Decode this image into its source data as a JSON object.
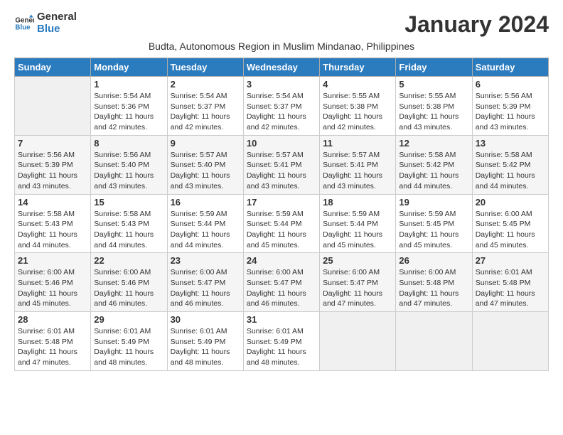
{
  "logo": {
    "line1": "General",
    "line2": "Blue"
  },
  "title": "January 2024",
  "subtitle": "Budta, Autonomous Region in Muslim Mindanao, Philippines",
  "headers": [
    "Sunday",
    "Monday",
    "Tuesday",
    "Wednesday",
    "Thursday",
    "Friday",
    "Saturday"
  ],
  "weeks": [
    [
      {
        "day": "",
        "info": ""
      },
      {
        "day": "1",
        "info": "Sunrise: 5:54 AM\nSunset: 5:36 PM\nDaylight: 11 hours\nand 42 minutes."
      },
      {
        "day": "2",
        "info": "Sunrise: 5:54 AM\nSunset: 5:37 PM\nDaylight: 11 hours\nand 42 minutes."
      },
      {
        "day": "3",
        "info": "Sunrise: 5:54 AM\nSunset: 5:37 PM\nDaylight: 11 hours\nand 42 minutes."
      },
      {
        "day": "4",
        "info": "Sunrise: 5:55 AM\nSunset: 5:38 PM\nDaylight: 11 hours\nand 42 minutes."
      },
      {
        "day": "5",
        "info": "Sunrise: 5:55 AM\nSunset: 5:38 PM\nDaylight: 11 hours\nand 43 minutes."
      },
      {
        "day": "6",
        "info": "Sunrise: 5:56 AM\nSunset: 5:39 PM\nDaylight: 11 hours\nand 43 minutes."
      }
    ],
    [
      {
        "day": "7",
        "info": "Sunrise: 5:56 AM\nSunset: 5:39 PM\nDaylight: 11 hours\nand 43 minutes."
      },
      {
        "day": "8",
        "info": "Sunrise: 5:56 AM\nSunset: 5:40 PM\nDaylight: 11 hours\nand 43 minutes."
      },
      {
        "day": "9",
        "info": "Sunrise: 5:57 AM\nSunset: 5:40 PM\nDaylight: 11 hours\nand 43 minutes."
      },
      {
        "day": "10",
        "info": "Sunrise: 5:57 AM\nSunset: 5:41 PM\nDaylight: 11 hours\nand 43 minutes."
      },
      {
        "day": "11",
        "info": "Sunrise: 5:57 AM\nSunset: 5:41 PM\nDaylight: 11 hours\nand 43 minutes."
      },
      {
        "day": "12",
        "info": "Sunrise: 5:58 AM\nSunset: 5:42 PM\nDaylight: 11 hours\nand 44 minutes."
      },
      {
        "day": "13",
        "info": "Sunrise: 5:58 AM\nSunset: 5:42 PM\nDaylight: 11 hours\nand 44 minutes."
      }
    ],
    [
      {
        "day": "14",
        "info": "Sunrise: 5:58 AM\nSunset: 5:43 PM\nDaylight: 11 hours\nand 44 minutes."
      },
      {
        "day": "15",
        "info": "Sunrise: 5:58 AM\nSunset: 5:43 PM\nDaylight: 11 hours\nand 44 minutes."
      },
      {
        "day": "16",
        "info": "Sunrise: 5:59 AM\nSunset: 5:44 PM\nDaylight: 11 hours\nand 44 minutes."
      },
      {
        "day": "17",
        "info": "Sunrise: 5:59 AM\nSunset: 5:44 PM\nDaylight: 11 hours\nand 45 minutes."
      },
      {
        "day": "18",
        "info": "Sunrise: 5:59 AM\nSunset: 5:44 PM\nDaylight: 11 hours\nand 45 minutes."
      },
      {
        "day": "19",
        "info": "Sunrise: 5:59 AM\nSunset: 5:45 PM\nDaylight: 11 hours\nand 45 minutes."
      },
      {
        "day": "20",
        "info": "Sunrise: 6:00 AM\nSunset: 5:45 PM\nDaylight: 11 hours\nand 45 minutes."
      }
    ],
    [
      {
        "day": "21",
        "info": "Sunrise: 6:00 AM\nSunset: 5:46 PM\nDaylight: 11 hours\nand 45 minutes."
      },
      {
        "day": "22",
        "info": "Sunrise: 6:00 AM\nSunset: 5:46 PM\nDaylight: 11 hours\nand 46 minutes."
      },
      {
        "day": "23",
        "info": "Sunrise: 6:00 AM\nSunset: 5:47 PM\nDaylight: 11 hours\nand 46 minutes."
      },
      {
        "day": "24",
        "info": "Sunrise: 6:00 AM\nSunset: 5:47 PM\nDaylight: 11 hours\nand 46 minutes."
      },
      {
        "day": "25",
        "info": "Sunrise: 6:00 AM\nSunset: 5:47 PM\nDaylight: 11 hours\nand 47 minutes."
      },
      {
        "day": "26",
        "info": "Sunrise: 6:00 AM\nSunset: 5:48 PM\nDaylight: 11 hours\nand 47 minutes."
      },
      {
        "day": "27",
        "info": "Sunrise: 6:01 AM\nSunset: 5:48 PM\nDaylight: 11 hours\nand 47 minutes."
      }
    ],
    [
      {
        "day": "28",
        "info": "Sunrise: 6:01 AM\nSunset: 5:48 PM\nDaylight: 11 hours\nand 47 minutes."
      },
      {
        "day": "29",
        "info": "Sunrise: 6:01 AM\nSunset: 5:49 PM\nDaylight: 11 hours\nand 48 minutes."
      },
      {
        "day": "30",
        "info": "Sunrise: 6:01 AM\nSunset: 5:49 PM\nDaylight: 11 hours\nand 48 minutes."
      },
      {
        "day": "31",
        "info": "Sunrise: 6:01 AM\nSunset: 5:49 PM\nDaylight: 11 hours\nand 48 minutes."
      },
      {
        "day": "",
        "info": ""
      },
      {
        "day": "",
        "info": ""
      },
      {
        "day": "",
        "info": ""
      }
    ]
  ]
}
